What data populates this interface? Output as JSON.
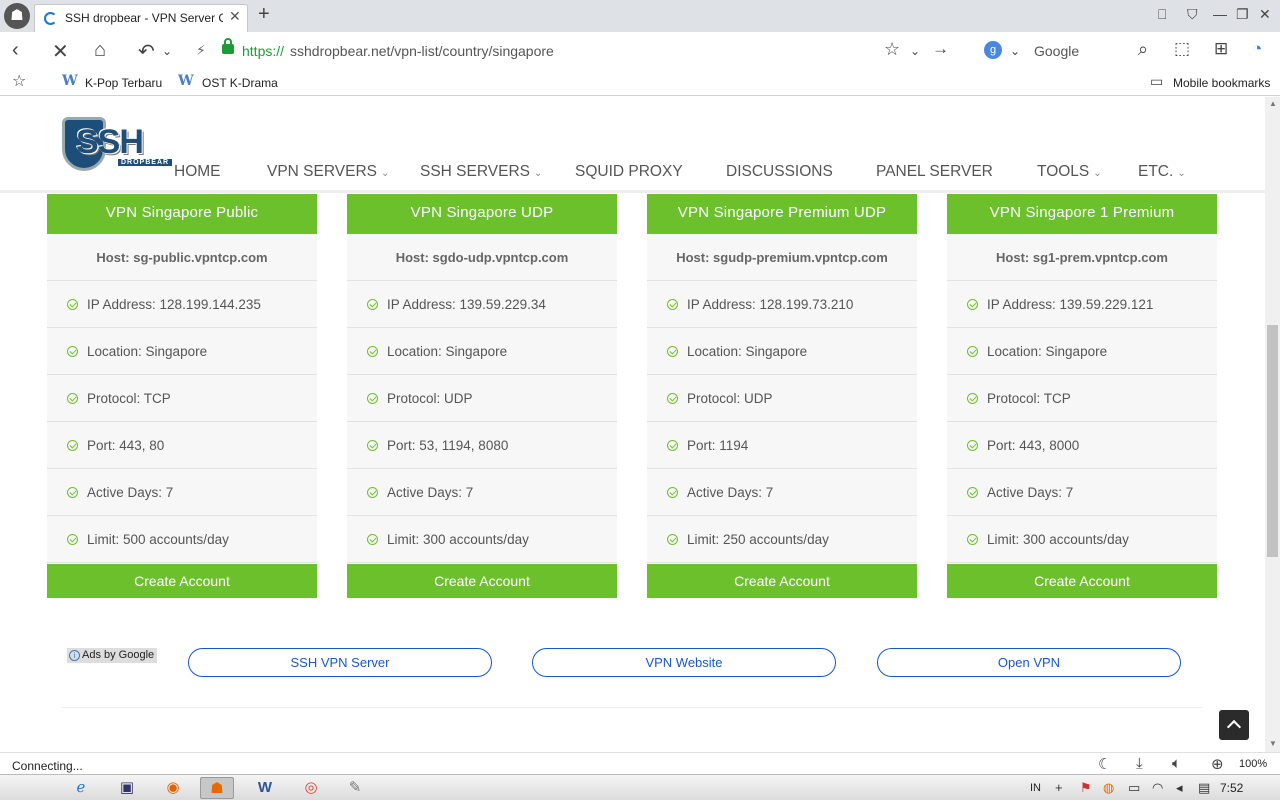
{
  "browser": {
    "tab_title": "SSH dropbear - VPN Server Co",
    "url_https": "https://",
    "url_rest": "sshdropbear.net/vpn-list/country/singapore",
    "search_engine_letter": "g",
    "search_label": "Google",
    "bookmarks": [
      {
        "icon": "W",
        "label": "K-Pop Terbaru"
      },
      {
        "icon": "W",
        "label": "OST K-Drama"
      }
    ],
    "mobile_bookmarks": "Mobile bookmarks",
    "status": "Connecting...",
    "zoom": "100%"
  },
  "site": {
    "logo_text": "SSH",
    "logo_sub": "DROPBEAR",
    "menu": [
      {
        "label": "HOME",
        "has_dropdown": false
      },
      {
        "label": "VPN SERVERS",
        "has_dropdown": true
      },
      {
        "label": "SSH SERVERS",
        "has_dropdown": true
      },
      {
        "label": "SQUID PROXY",
        "has_dropdown": false
      },
      {
        "label": "DISCUSSIONS",
        "has_dropdown": false
      },
      {
        "label": "PANEL SERVER",
        "has_dropdown": false
      },
      {
        "label": "TOOLS",
        "has_dropdown": true
      },
      {
        "label": "ETC.",
        "has_dropdown": true
      }
    ]
  },
  "servers": [
    {
      "title": "VPN Singapore Public",
      "host": "Host: sg-public.vpntcp.com",
      "ip": "IP Address: 128.199.144.235",
      "location": "Location: Singapore",
      "protocol": "Protocol: TCP",
      "port": "Port: 443, 80",
      "active_days": "Active Days: 7",
      "limit": "Limit: 500 accounts/day",
      "button": "Create Account"
    },
    {
      "title": "VPN Singapore UDP",
      "host": "Host: sgdo-udp.vpntcp.com",
      "ip": "IP Address: 139.59.229.34",
      "location": "Location: Singapore",
      "protocol": "Protocol: UDP",
      "port": "Port: 53, 1194, 8080",
      "active_days": "Active Days: 7",
      "limit": "Limit: 300 accounts/day",
      "button": "Create Account"
    },
    {
      "title": "VPN Singapore Premium UDP",
      "host": "Host: sgudp-premium.vpntcp.com",
      "ip": "IP Address: 128.199.73.210",
      "location": "Location: Singapore",
      "protocol": "Protocol: UDP",
      "port": "Port: 1194",
      "active_days": "Active Days: 7",
      "limit": "Limit: 250 accounts/day",
      "button": "Create Account"
    },
    {
      "title": "VPN Singapore 1 Premium",
      "host": "Host: sg1-prem.vpntcp.com",
      "ip": "IP Address: 139.59.229.121",
      "location": "Location: Singapore",
      "protocol": "Protocol: TCP",
      "port": "Port: 443, 8000",
      "active_days": "Active Days: 7",
      "limit": "Limit: 300 accounts/day",
      "button": "Create Account"
    }
  ],
  "ads": {
    "label": "Ads by Google",
    "links": [
      "SSH VPN Server",
      "VPN Website",
      "Open VPN"
    ]
  },
  "taskbar": {
    "lang": "IN",
    "clock": "7:52"
  },
  "colors": {
    "accent_green": "#6cc02c",
    "link_blue": "#1a57c9",
    "secure_green": "#1e9b36"
  }
}
